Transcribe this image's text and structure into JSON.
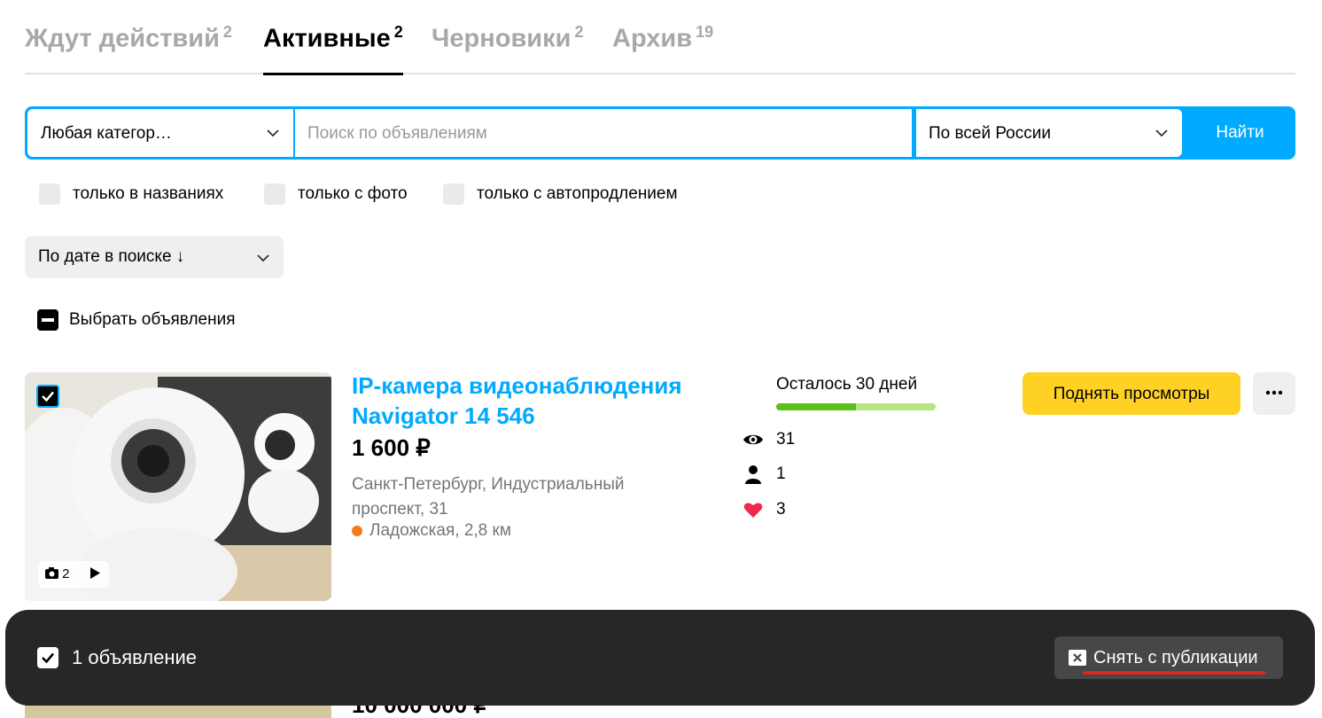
{
  "tabs": [
    {
      "label": "Ждут действий",
      "count": "2",
      "active": false
    },
    {
      "label": "Активные",
      "count": "2",
      "active": true
    },
    {
      "label": "Черновики",
      "count": "2",
      "active": false
    },
    {
      "label": "Архив",
      "count": "19",
      "active": false
    }
  ],
  "search": {
    "category": "Любая категор…",
    "placeholder": "Поиск по объявлениям",
    "region": "По всей России",
    "button": "Найти"
  },
  "filters": [
    {
      "label": "только в названиях",
      "checked": false
    },
    {
      "label": "только с фото",
      "checked": false
    },
    {
      "label": "только с автопродлением",
      "checked": false
    }
  ],
  "sort": {
    "label": "По дате в поиске ↓"
  },
  "select_all": {
    "label": "Выбрать объявления"
  },
  "listing": {
    "title": "IP-камера видеонаблюдения Navigator 14 546",
    "price": "1 600 ₽",
    "address": "Санкт-Петербург, Индустриальный проспект, 31",
    "metro": "Ладожская, 2,8 км",
    "photo_count": "2",
    "days_left": "Осталось 30 дней",
    "days_progress": 0.5,
    "views": "31",
    "contacts": "1",
    "favorites": "3",
    "promo_button": "Поднять просмотры",
    "selected": true
  },
  "listing2": {
    "price": "10 000 000 ₽"
  },
  "action_bar": {
    "count_label": "1 объявление",
    "unpublish": "Снять с публикации"
  },
  "colors": {
    "accent": "#00aaff",
    "promo": "#ffd124",
    "progress": "#57c11a",
    "metro_line": "#f07c1e"
  }
}
